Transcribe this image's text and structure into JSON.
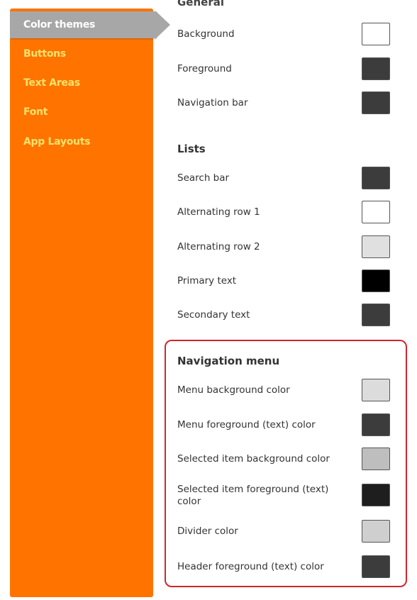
{
  "sidebar": {
    "items": [
      {
        "label": "Color themes",
        "selected": true
      },
      {
        "label": "Buttons"
      },
      {
        "label": "Text Areas"
      },
      {
        "label": "Font"
      },
      {
        "label": "App Layouts"
      }
    ]
  },
  "general": {
    "title": "General",
    "rows": [
      {
        "label": "Background",
        "color": "#ffffff"
      },
      {
        "label": "Foreground",
        "color": "#3c3c3c"
      },
      {
        "label": "Navigation bar",
        "color": "#3c3c3c"
      }
    ]
  },
  "lists": {
    "title": "Lists",
    "rows": [
      {
        "label": "Search bar",
        "color": "#3c3c3c"
      },
      {
        "label": "Alternating row 1",
        "color": "#ffffff"
      },
      {
        "label": "Alternating row 2",
        "color": "#e0e0e0"
      },
      {
        "label": "Primary text",
        "color": "#000000"
      },
      {
        "label": "Secondary text",
        "color": "#3c3c3c"
      }
    ]
  },
  "navigation_menu": {
    "title": "Navigation menu",
    "rows": [
      {
        "label": "Menu background color",
        "color": "#dcdcdc"
      },
      {
        "label": "Menu foreground (text) color",
        "color": "#3c3c3c"
      },
      {
        "label": "Selected item background color",
        "color": "#bebebe"
      },
      {
        "label": "Selected item foreground (text) color",
        "color": "#1e1e1e"
      },
      {
        "label": "Divider color",
        "color": "#cfcfcf"
      },
      {
        "label": "Header foreground (text) color",
        "color": "#3c3c3c"
      }
    ]
  },
  "highlight_color": "#d0262d",
  "sidebar_color": "#ff7400"
}
